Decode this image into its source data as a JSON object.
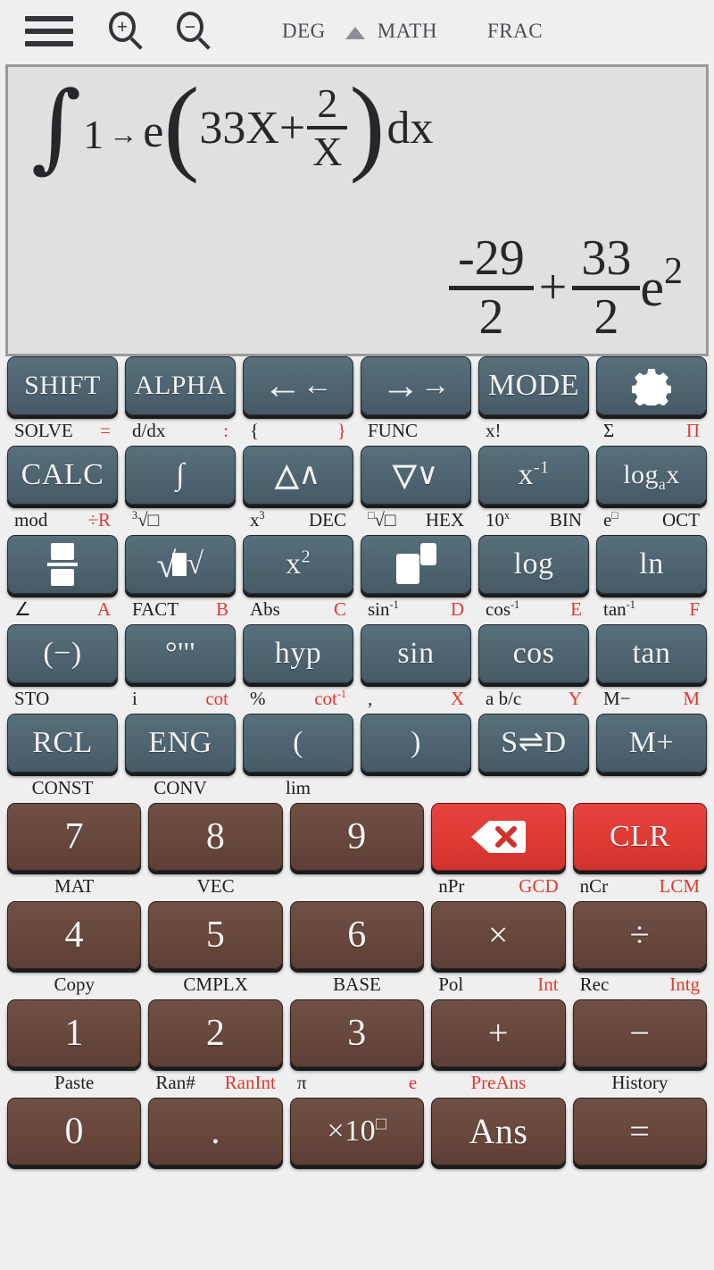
{
  "topbar": {
    "menu_icon": "hamburger-icon",
    "zoom_in_icon": "zoom-in-icon",
    "zoom_in_sign": "+",
    "zoom_out_icon": "zoom-out-icon",
    "zoom_out_sign": "−",
    "angle_mode": "DEG",
    "shift_indicator": "▲",
    "math_mode": "MATH",
    "frac_mode": "FRAC"
  },
  "display": {
    "expression": {
      "integral_symbol": "∫",
      "lower_limit": "1",
      "limit_arrow": "→",
      "upper_limit": "e",
      "open_paren": "(",
      "term1": "33X+",
      "frac_num": "2",
      "frac_den": "X",
      "close_paren": ")",
      "differential": "dx",
      "plain_text": "∫1→e(33X+2/X)dx"
    },
    "result": {
      "frac1_num": "-29",
      "frac1_den": "2",
      "plus": "+",
      "frac2_num": "33",
      "frac2_den": "2",
      "e_symbol": "e",
      "e_exponent": "2",
      "plain_text": "-29/2 + 33/2 e^2"
    }
  },
  "colors": {
    "page_bg": "#efefef",
    "display_bg": "#e0e0e0",
    "display_border": "#9a9a9a",
    "teal_key": "#4e6470",
    "brown_key": "#68473c",
    "red_key": "#de3a34",
    "sub_label": "#1d1d22",
    "sub_label_alt": "#e23a2e"
  },
  "keypad": {
    "rows": [
      {
        "keys": [
          {
            "label": "SHIFT",
            "style": "teal",
            "sub_left": "SOLVE",
            "sub_right": "="
          },
          {
            "label": "ALPHA",
            "style": "teal",
            "sub_left": "d/dx",
            "sub_right": ":"
          },
          {
            "label": "←",
            "style": "teal",
            "icon": "arrow-left-icon",
            "sub_left": "{",
            "sub_right": "}"
          },
          {
            "label": "→",
            "style": "teal",
            "icon": "arrow-right-icon",
            "sub_left": "FUNC",
            "sub_right": ""
          },
          {
            "label": "MODE",
            "style": "teal",
            "sub_left": "x!",
            "sub_right": ""
          },
          {
            "label": "",
            "style": "teal",
            "icon": "gear-icon",
            "sub_left": "Σ",
            "sub_right": "Π"
          }
        ]
      },
      {
        "keys": [
          {
            "label": "CALC",
            "style": "teal",
            "sub_left": "mod",
            "sub_right": "÷R"
          },
          {
            "label": "∫",
            "style": "teal",
            "sub_left": "³√□",
            "sub_right": ""
          },
          {
            "label": "∧",
            "style": "teal",
            "icon": "chevron-up-icon",
            "sub_left": "x³",
            "sub_right": "DEC",
            "sub_right_dark": true
          },
          {
            "label": "∨",
            "style": "teal",
            "icon": "chevron-down-icon",
            "sub_left": "□√□",
            "sub_right": "HEX",
            "sub_right_dark": true
          },
          {
            "label": "x⁻¹",
            "style": "teal",
            "sub_left": "10ˣ",
            "sub_right": "BIN",
            "sub_right_dark": true
          },
          {
            "label": "logₐx",
            "style": "teal",
            "sub_left": "e□",
            "sub_right": "OCT",
            "sub_right_dark": true
          }
        ]
      },
      {
        "keys": [
          {
            "label": "",
            "style": "teal",
            "icon": "fraction-icon",
            "sub_left": "∠",
            "sub_right": "A"
          },
          {
            "label": "√",
            "style": "teal",
            "icon": "sqrt-icon",
            "sub_left": "FACT",
            "sub_right": "B"
          },
          {
            "label": "x²",
            "style": "teal",
            "sub_left": "Abs",
            "sub_right": "C"
          },
          {
            "label": "",
            "style": "teal",
            "icon": "power-icon",
            "sub_left": "sin⁻¹",
            "sub_right": "D"
          },
          {
            "label": "log",
            "style": "teal",
            "sub_left": "cos⁻¹",
            "sub_right": "E"
          },
          {
            "label": "ln",
            "style": "teal",
            "sub_left": "tan⁻¹",
            "sub_right": "F"
          }
        ]
      },
      {
        "keys": [
          {
            "label": "(−)",
            "style": "teal",
            "sub_left": "STO",
            "sub_right": ""
          },
          {
            "label": "°'''",
            "style": "teal",
            "sub_left": "i",
            "sub_right": "cot"
          },
          {
            "label": "hyp",
            "style": "teal",
            "sub_left": "%",
            "sub_right": "cot⁻¹"
          },
          {
            "label": "sin",
            "style": "teal",
            "sub_left": ",",
            "sub_right": "X"
          },
          {
            "label": "cos",
            "style": "teal",
            "sub_left": "a b/c",
            "sub_right": "Y"
          },
          {
            "label": "tan",
            "style": "teal",
            "sub_left": "M−",
            "sub_right": "M"
          }
        ]
      },
      {
        "keys": [
          {
            "label": "RCL",
            "style": "teal",
            "sub_left": "CONST",
            "sub_center": true
          },
          {
            "label": "ENG",
            "style": "teal",
            "sub_left": "CONV",
            "sub_center": true
          },
          {
            "label": "(",
            "style": "teal",
            "sub_left": "lim",
            "sub_center": true
          },
          {
            "label": ")",
            "style": "teal",
            "sub_left": "",
            "sub_right": ""
          },
          {
            "label": "S⇌D",
            "style": "teal",
            "sub_left": "",
            "sub_right": ""
          },
          {
            "label": "M+",
            "style": "teal",
            "sub_left": "",
            "sub_right": ""
          }
        ]
      }
    ],
    "numrows": [
      {
        "keys": [
          {
            "label": "7",
            "style": "brown",
            "sub_left": "MAT",
            "sub_center": true
          },
          {
            "label": "8",
            "style": "brown",
            "sub_left": "VEC",
            "sub_center": true
          },
          {
            "label": "9",
            "style": "brown",
            "sub_left": "",
            "sub_center": true
          },
          {
            "label": "",
            "style": "red",
            "icon": "delete-icon",
            "sub_left": "nPr",
            "sub_right": "GCD"
          },
          {
            "label": "CLR",
            "style": "red",
            "sub_left": "nCr",
            "sub_right": "LCM"
          }
        ]
      },
      {
        "keys": [
          {
            "label": "4",
            "style": "brown",
            "sub_left": "Copy",
            "sub_center": true
          },
          {
            "label": "5",
            "style": "brown",
            "sub_left": "CMPLX",
            "sub_center": true
          },
          {
            "label": "6",
            "style": "brown",
            "sub_left": "BASE",
            "sub_center": true
          },
          {
            "label": "×",
            "style": "brown",
            "sub_left": "Pol",
            "sub_right": "Int"
          },
          {
            "label": "÷",
            "style": "brown",
            "sub_left": "Rec",
            "sub_right": "Intg"
          }
        ]
      },
      {
        "keys": [
          {
            "label": "1",
            "style": "brown",
            "sub_left": "Paste",
            "sub_center": true
          },
          {
            "label": "2",
            "style": "brown",
            "sub_left": "Ran#",
            "sub_right": "RanInt"
          },
          {
            "label": "3",
            "style": "brown",
            "sub_left": "π",
            "sub_right": "e"
          },
          {
            "label": "+",
            "style": "brown",
            "sub_left": "",
            "sub_right": "PreAns",
            "sub_center_red": true
          },
          {
            "label": "−",
            "style": "brown",
            "sub_left": "History",
            "sub_center": true
          }
        ]
      },
      {
        "keys": [
          {
            "label": "0",
            "style": "brown"
          },
          {
            "label": ".",
            "style": "brown"
          },
          {
            "label": "×10□",
            "style": "brown"
          },
          {
            "label": "Ans",
            "style": "brown"
          },
          {
            "label": "=",
            "style": "brown"
          }
        ]
      }
    ]
  }
}
